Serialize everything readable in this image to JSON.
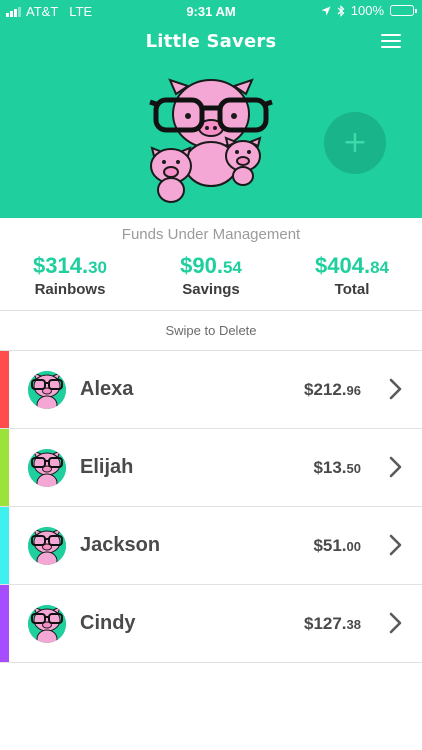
{
  "status_bar": {
    "carrier": "AT&T",
    "network": "LTE",
    "time": "9:31 AM",
    "battery": "100%"
  },
  "app": {
    "title": "Little Savers",
    "accent_color": "#1fcf9e",
    "add_button_icon": "+"
  },
  "funds": {
    "title": "Funds Under Management",
    "items": [
      {
        "dollars": "$314.",
        "cents": "30",
        "label": "Rainbows"
      },
      {
        "dollars": "$90.",
        "cents": "54",
        "label": "Savings"
      },
      {
        "dollars": "$404.",
        "cents": "84",
        "label": "Total"
      }
    ]
  },
  "swipe_hint": "Swipe to Delete",
  "children": [
    {
      "name": "Alexa",
      "dollars": "$212.",
      "cents": "96",
      "color": "#ff4d4d"
    },
    {
      "name": "Elijah",
      "dollars": "$13.",
      "cents": "50",
      "color": "#9be23a"
    },
    {
      "name": "Jackson",
      "dollars": "$51.",
      "cents": "00",
      "color": "#3ff0f0"
    },
    {
      "name": "Cindy",
      "dollars": "$127.",
      "cents": "38",
      "color": "#a64dff"
    }
  ],
  "icons": {
    "menu": "hamburger-menu-icon",
    "add": "plus-icon",
    "chevron": "chevron-right-icon",
    "location": "location-arrow-icon",
    "bluetooth": "bluetooth-icon"
  }
}
